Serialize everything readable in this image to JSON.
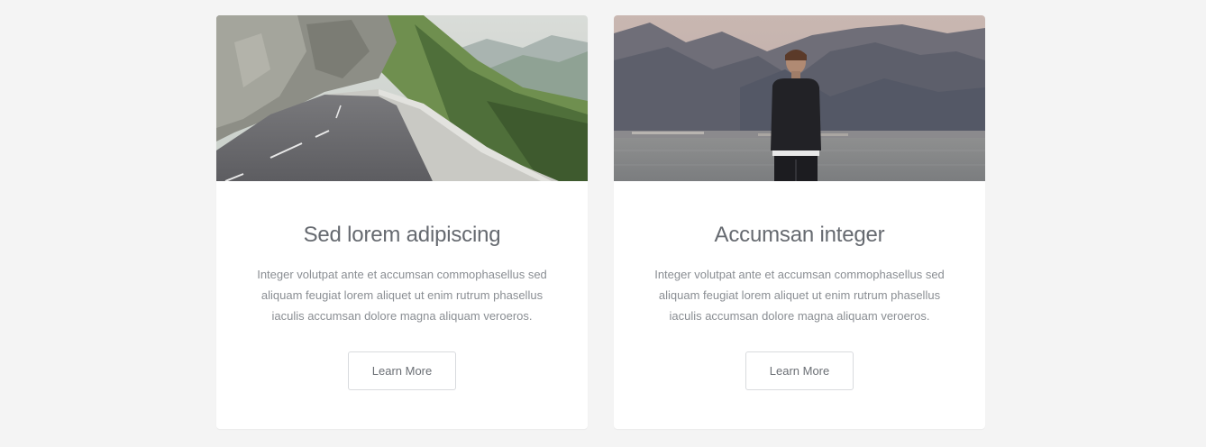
{
  "cards": [
    {
      "image_name": "mountain-road-image",
      "title": "Sed lorem adipiscing",
      "description": "Integer volutpat ante et accumsan commophasellus sed aliquam feugiat lorem aliquet ut enim rutrum phasellus iaculis accumsan dolore magna aliquam veroeros.",
      "button_label": "Learn More"
    },
    {
      "image_name": "man-at-lake-image",
      "title": "Accumsan integer",
      "description": "Integer volutpat ante et accumsan commophasellus sed aliquam feugiat lorem aliquet ut enim rutrum phasellus iaculis accumsan dolore magna aliquam veroeros.",
      "button_label": "Learn More"
    }
  ],
  "colors": {
    "page_background": "#f4f4f4",
    "card_background": "#ffffff",
    "title_text": "#666a70",
    "body_text": "#8a8e93",
    "button_border": "#d9dbde"
  }
}
